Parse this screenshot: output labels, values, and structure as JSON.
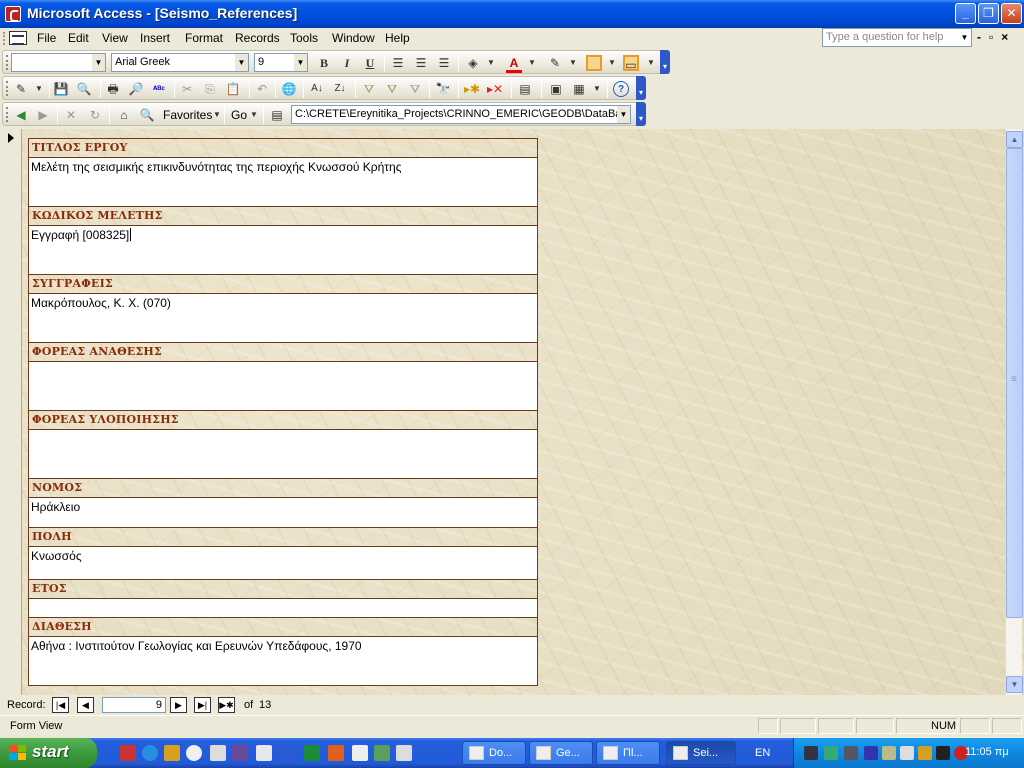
{
  "window": {
    "title": "Microsoft Access - [Seismo_References]"
  },
  "menu": {
    "items": [
      "File",
      "Edit",
      "View",
      "Insert",
      "Format",
      "Records",
      "Tools",
      "Window",
      "Help"
    ],
    "help_placeholder": "Type a question for help"
  },
  "toolbar": {
    "object_combo": "",
    "font_name": "Arial Greek",
    "font_size": "9",
    "bold": "B",
    "italic": "I",
    "underline": "U",
    "favorites": "Favorites",
    "go": "Go",
    "address": "C:\\CRETE\\Ereynitika_Projects\\CRINNO_EMERIC\\GEODB\\DataBase"
  },
  "form": {
    "fields": [
      {
        "label": "ΤΙΤΛΟΣ ΕΡΓΟΥ",
        "value": "Μελέτη της σεισμικής επικινδυνότητας της περιοχής Κνωσσού Κρήτης"
      },
      {
        "label": "ΚΩΔΙΚΟΣ ΜΕΛΕΤΗΣ",
        "value": "Εγγραφή [008325]"
      },
      {
        "label": "ΣΥΓΓΡΑΦΕΙΣ",
        "value": "Μακρόπουλος, Κ. Χ. (070)"
      },
      {
        "label": "ΦΟΡΕΑΣ ΑΝΑΘΕΣΗΣ",
        "value": ""
      },
      {
        "label": "ΦΟΡΕΑΣ ΥΛΟΠΟΙΗΣΗΣ",
        "value": ""
      },
      {
        "label": "ΝΟΜΟΣ",
        "value": "Ηράκλειο"
      },
      {
        "label": "ΠΟΛΗ",
        "value": "Κνωσσός"
      },
      {
        "label": "ΕΤΟΣ",
        "value": ""
      },
      {
        "label": "ΔΙΑΘΕΣΗ",
        "value": "Αθήνα : Ινστιτούτον Γεωλογίας και Ερευνών Υπεδάφους, 1970"
      }
    ]
  },
  "record_nav": {
    "label": "Record:",
    "current": "9",
    "of": "of",
    "total": "13"
  },
  "status": {
    "text": "Form View",
    "num": "NUM"
  },
  "taskbar": {
    "start": "start",
    "tasks": [
      "Do...",
      "Ge...",
      "Πl...",
      "Sei..."
    ],
    "language": "EN",
    "clock": "11:05 πμ"
  }
}
